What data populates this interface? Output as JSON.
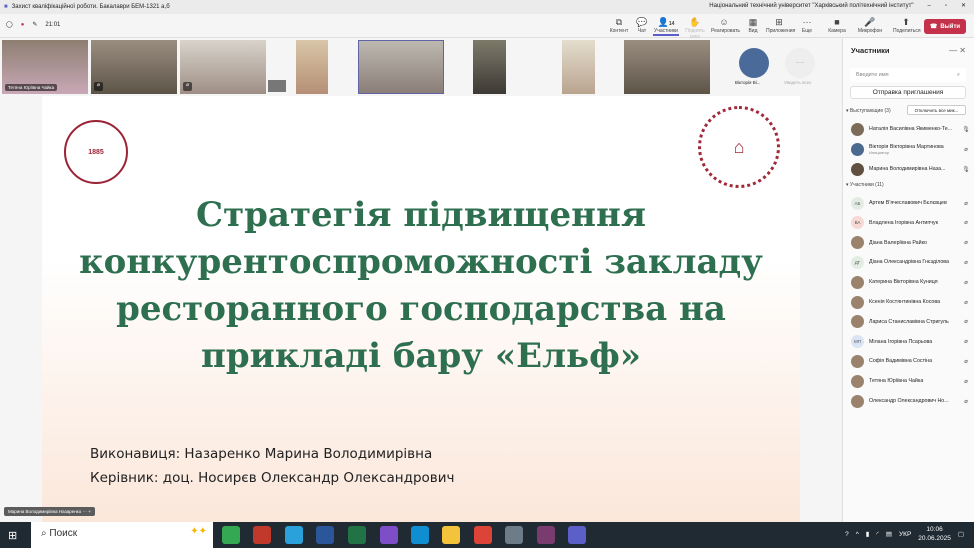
{
  "window": {
    "title": "Захист кваліфікаційної роботи. Бакалаври БЕМ-1321 a,б",
    "org": "Національний технічний університет \"Харківський політехнічний інститут\""
  },
  "toolbar": {
    "timer": "21:01",
    "participants_count": "14",
    "buttons": [
      "Контент",
      "Чат",
      "Участники",
      "Поднять руку",
      "Реагировать",
      "Вид",
      "Приложения",
      "Еще",
      "Камера",
      "Микрофон",
      "Поделиться"
    ],
    "leave": "Выйти"
  },
  "strip": {
    "tiles": [
      {
        "name": "Тетяна Юріївна Чайка"
      },
      {
        "name": ""
      },
      {
        "name": ""
      },
      {
        "name": ""
      },
      {
        "name": ""
      },
      {
        "name": ""
      },
      {
        "name": ""
      },
      {
        "name": ""
      },
      {
        "name": ""
      }
    ],
    "avatar_name": "Вікторія Ві...",
    "view_all": "Увидеть всех"
  },
  "slide": {
    "title": "Стратегія підвищення конкурентоспроможності закладу ресторанного господарства на прикладі бару «Ельф»",
    "author": "Виконавиця: Назаренко Марина Володимирівна",
    "supervisor": "Керівник: доц. Носирєв Олександр Олександрович",
    "seal_year": "1885"
  },
  "speaker_tag": "Марина Володимирівна Назаренко",
  "panel": {
    "title": "Участники",
    "search_placeholder": "Введите имя",
    "invite": "Отправка приглашения",
    "presenters_label": "Выступающие (3)",
    "mute_all": "Отключить все мик...",
    "attendees_label": "Участники (11)",
    "presenters": [
      {
        "name": "Наталія Василівна Якименко-Те...",
        "mic": "on"
      },
      {
        "name": "Вікторія Вікторівна Мартинова",
        "role": "Инициатор",
        "mic": "off"
      },
      {
        "name": "Марина Володимирівна Наза...",
        "mic": "on"
      }
    ],
    "attendees": [
      {
        "name": "Артем В'ячеславович Бєлєвцев",
        "initials": "АБ"
      },
      {
        "name": "Владлена Ігорівна Антипчук",
        "initials": "ВА"
      },
      {
        "name": "Діана Валеріївна Райко",
        "initials": ""
      },
      {
        "name": "Діана Олександрівна Гнєзділова",
        "initials": "ДГ"
      },
      {
        "name": "Катерина Вікторівна Куниця",
        "initials": ""
      },
      {
        "name": "Ксенія Костянтинівна Косова",
        "initials": ""
      },
      {
        "name": "Лариса Станиславівна Стригуль",
        "initials": ""
      },
      {
        "name": "Мілана Ігорівна Псарьова",
        "initials": "МП"
      },
      {
        "name": "Софія Вадимівна Состіна",
        "initials": ""
      },
      {
        "name": "Тетяна Юріївна Чайка",
        "initials": ""
      },
      {
        "name": "Олександр Олександрович Но...",
        "initials": ""
      }
    ]
  },
  "taskbar": {
    "search": "Поиск",
    "lang": "УКР",
    "time": "10:06",
    "date": "20.06.2025"
  }
}
